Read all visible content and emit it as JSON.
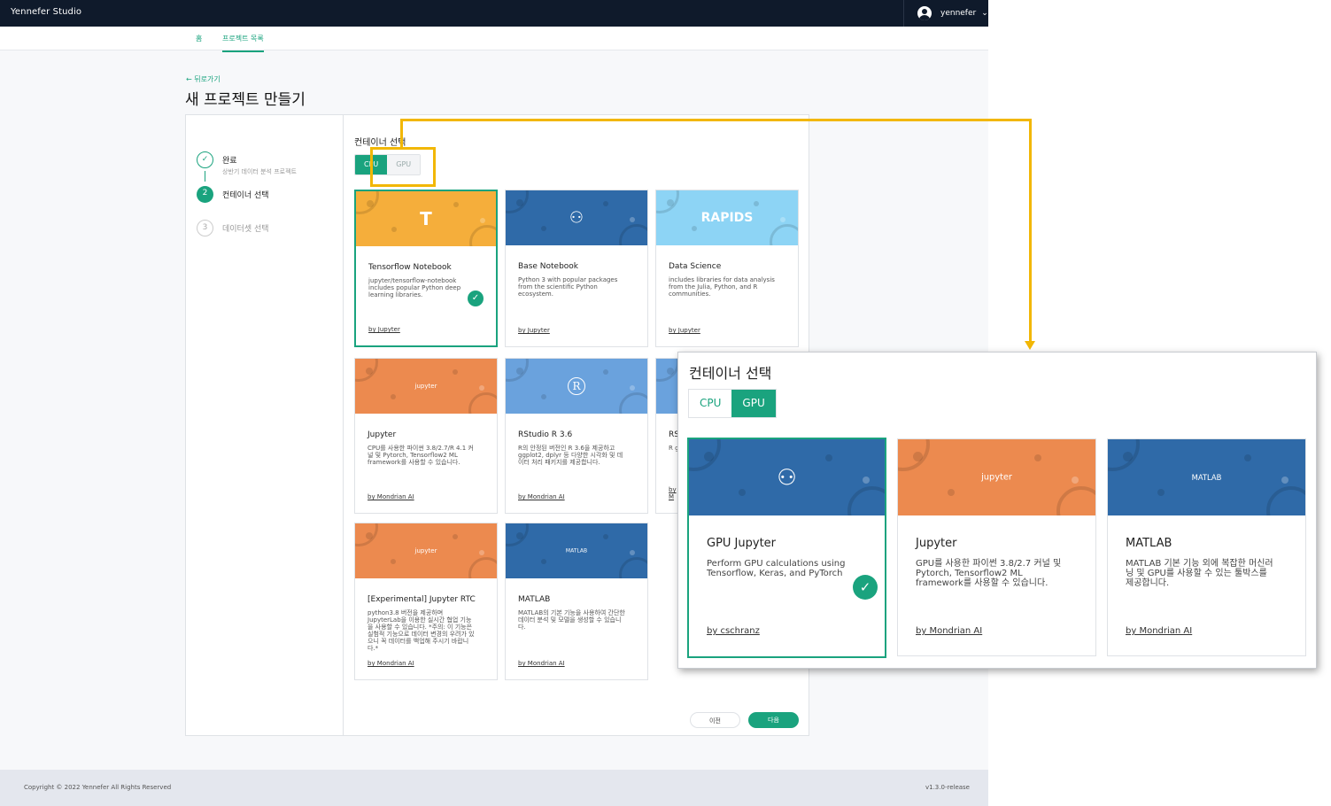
{
  "app": {
    "brand": "Yennefer Studio",
    "user": "yennefer"
  },
  "nav": {
    "home": "홈",
    "projects": "프로젝트 목록"
  },
  "header": {
    "back": "← 뒤로가기",
    "title": "새 프로젝트 만들기"
  },
  "steps": [
    {
      "num": "✓",
      "label": "완료",
      "sub": "상반기 데이터 분석 프로젝트"
    },
    {
      "num": "2",
      "label": "컨테이너 선택",
      "sub": ""
    },
    {
      "num": "3",
      "label": "데이터셋 선택",
      "sub": ""
    }
  ],
  "container": {
    "title": "컨테이너 선택",
    "tabs": [
      "CPU",
      "GPU"
    ],
    "selected_tab": "CPU",
    "cards": [
      {
        "title": "Tensorflow Notebook",
        "desc": "jupyter/tensorflow-notebook includes popular Python deep learning libraries.",
        "by": "by Jupyter",
        "banner_color": "#f5ae3b",
        "icon": "tensorflow-icon",
        "glyph": "T",
        "selected": true
      },
      {
        "title": "Base Notebook",
        "desc": "Python 3 with popular packages from the scientific Python ecosystem.",
        "by": "by Jupyter",
        "banner_color": "#2f6aa8",
        "icon": "python-icon",
        "glyph": "⚇",
        "selected": false
      },
      {
        "title": "Data Science",
        "desc": "includes libraries for data analysis from the Julia, Python, and R communities.",
        "by": "by Jupyter",
        "banner_color": "#8dd4f5",
        "icon": "rapids-logo",
        "glyph": "RAPIDS",
        "selected": false
      },
      {
        "title": "Jupyter",
        "desc": "CPU를 사용한 파이썬 3.8/2.7/R 4.1 커널 및 Pytorch, Tensorflow2 ML framework를 사용할 수 있습니다.",
        "by": "by Mondrian AI",
        "banner_color": "#ec8a4f",
        "icon": "jupyter-icon",
        "glyph": "jupyter",
        "selected": false
      },
      {
        "title": "RStudio R 3.6",
        "desc": "R의 안정된 버전인 R 3.6을 제공하고 ggplot2, dplyr 등 다양한 시각화 및 데이터 처리 패키지를 제공합니다.",
        "by": "by Mondrian AI",
        "banner_color": "#6aa2dd",
        "icon": "r-icon",
        "glyph": "R",
        "selected": false
      },
      {
        "title": "RS",
        "desc": "R ggp 화",
        "by": "by M",
        "banner_color": "#6aa2dd",
        "icon": "r-icon",
        "glyph": "",
        "selected": false
      },
      {
        "title": "[Experimental] Jupyter RTC",
        "desc": "python3.8 버전을 제공하며 JupyterLab을 이용한 실시간 협업 기능을 사용할 수 있습니다. *주의: 이 기능은 실험적 기능으로 데이터 변경의 우려가 있으니 꼭 데이터를 백업해 주시기 바랍니다.*",
        "by": "by Mondrian AI",
        "banner_color": "#ec8a4f",
        "icon": "jupyter-icon",
        "glyph": "jupyter",
        "selected": false
      },
      {
        "title": "MATLAB",
        "desc": "MATLAB의 기본 기능을 사용하여 간단한 데이터 분석 및 모델을 생성할 수 있습니다.",
        "by": "by Mondrian AI",
        "banner_color": "#2f6aa8",
        "icon": "matlab-icon",
        "glyph": "MATLAB",
        "selected": false
      }
    ]
  },
  "buttons": {
    "prev": "이전",
    "next": "다음"
  },
  "footer": {
    "copyright": "Copyright © 2022 Yennefer All Rights Reserved",
    "version": "v1.3.0-release"
  },
  "zoom": {
    "title": "컨테이너 선택",
    "tabs": [
      "CPU",
      "GPU"
    ],
    "selected_tab": "GPU",
    "cards": [
      {
        "title": "GPU Jupyter",
        "desc": "Perform GPU calculations using Tensorflow, Keras, and PyTorch",
        "by": "by cschranz",
        "banner_color": "#2f6aa8",
        "icon": "python-icon",
        "glyph": "⚇",
        "selected": true
      },
      {
        "title": "Jupyter",
        "desc": "GPU를 사용한 파이썬 3.8/2.7 커널 및 Pytorch, Tensorflow2 ML framework를 사용할 수 있습니다.",
        "by": "by Mondrian AI",
        "banner_color": "#ec8a4f",
        "icon": "jupyter-icon",
        "glyph": "jupyter",
        "selected": false
      },
      {
        "title": "MATLAB",
        "desc": "MATLAB 기본 기능 외에 복잡한 머신러닝 및 GPU를 사용할 수 있는 툴박스를 제공합니다.",
        "by": "by Mondrian AI",
        "banner_color": "#2f6aa8",
        "icon": "matlab-icon",
        "glyph": "MATLAB",
        "selected": false
      }
    ]
  },
  "colors": {
    "accent": "#1aa37e",
    "annotation": "#f2b705",
    "topbar": "#0f1a2b"
  }
}
